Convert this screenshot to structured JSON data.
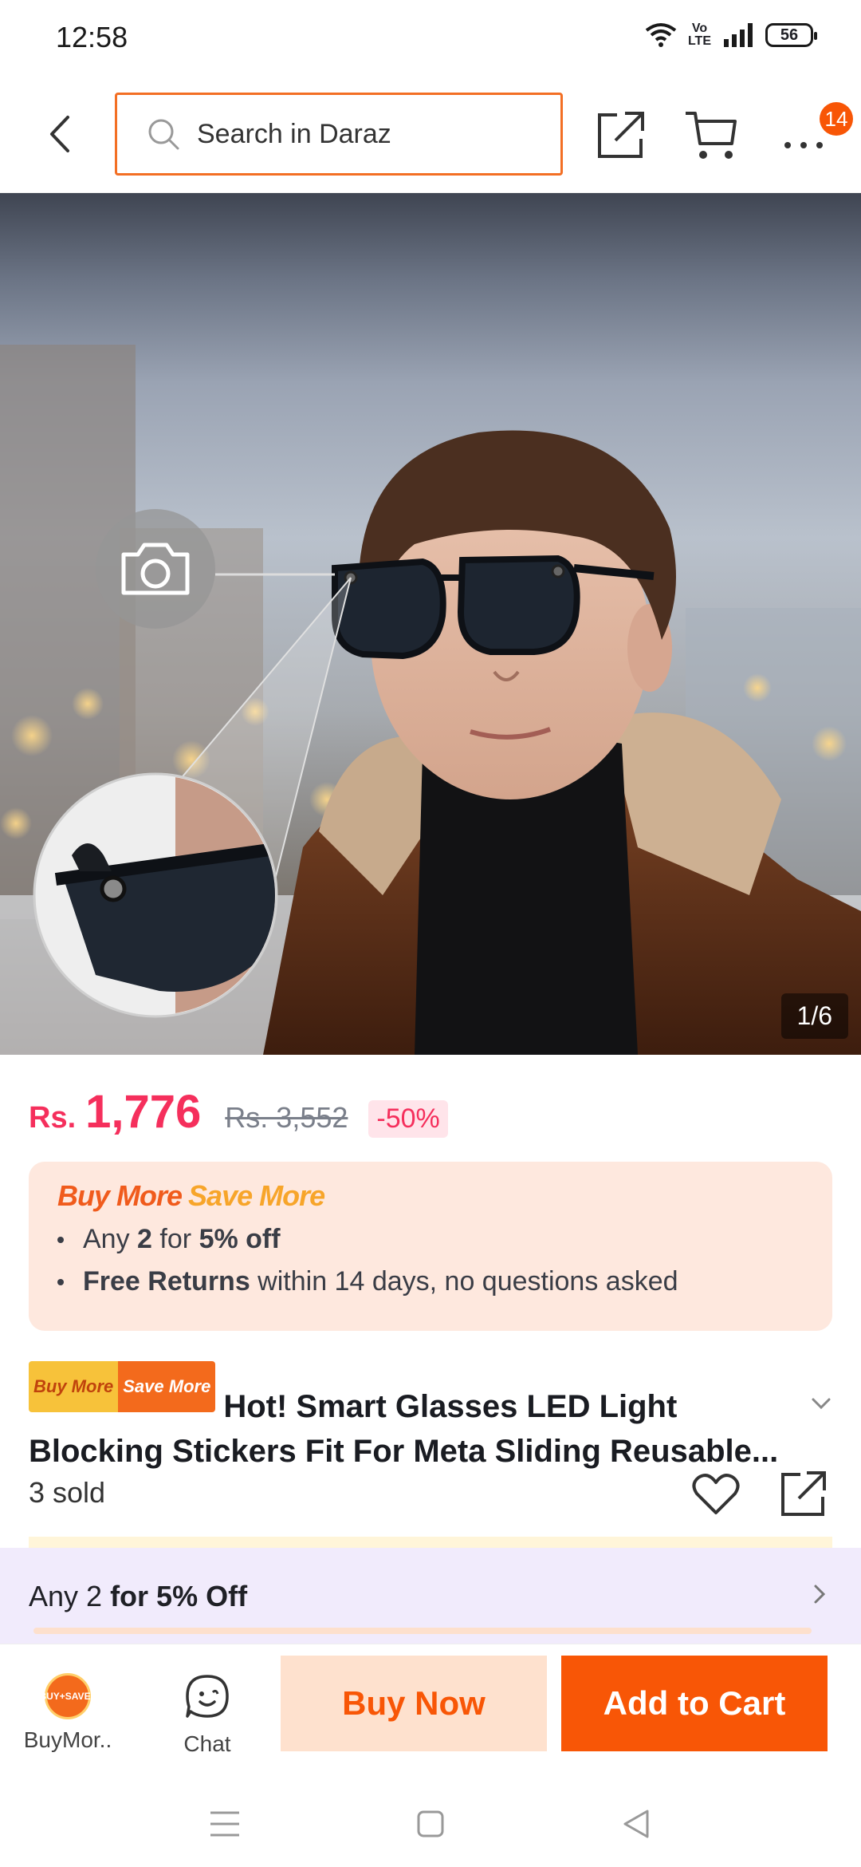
{
  "status_bar": {
    "time": "12:58",
    "battery": "56",
    "volte_top": "Vo",
    "volte_bottom": "LTE"
  },
  "header": {
    "search_placeholder": "Search in Daraz",
    "notification_count": "14"
  },
  "gallery": {
    "counter": "1/6"
  },
  "price": {
    "currency": "Rs.",
    "current": "1,776",
    "original": "Rs. 3,552",
    "discount": "-50%"
  },
  "promo": {
    "title_part1": "Buy More",
    "title_part2": "Save More",
    "line1_prefix": "Any ",
    "line1_count": "2",
    "line1_mid": " for ",
    "line1_offer": "5% off",
    "line2_bold": "Free Returns",
    "line2_rest": " within 14 days, no questions asked"
  },
  "product": {
    "tag_part1": "Buy More",
    "tag_part2": "Save More",
    "title": "Hot!  Smart Glasses LED Light Blocking Stickers Fit For Meta Sliding Reusable...",
    "sold": "3 sold"
  },
  "offer": {
    "prefix": "Any 2 ",
    "bold": "for 5% Off"
  },
  "bottom_bar": {
    "buy_more_icon_text": "BUY+SAVE+",
    "buy_more_label": "BuyMor..",
    "chat_label": "Chat",
    "buy_now": "Buy Now",
    "add_to_cart": "Add to Cart"
  },
  "colors": {
    "accent": "#f85606",
    "price": "#f52f5c",
    "search_border": "#f36f24"
  },
  "icons": [
    "back-arrow-icon",
    "search-icon",
    "share-icon",
    "cart-icon",
    "more-icon",
    "camera-icon",
    "chevron-down-icon",
    "heart-icon",
    "share-icon",
    "chevron-right-icon",
    "chat-icon",
    "menu-icon",
    "home-icon",
    "back-triangle-icon"
  ]
}
